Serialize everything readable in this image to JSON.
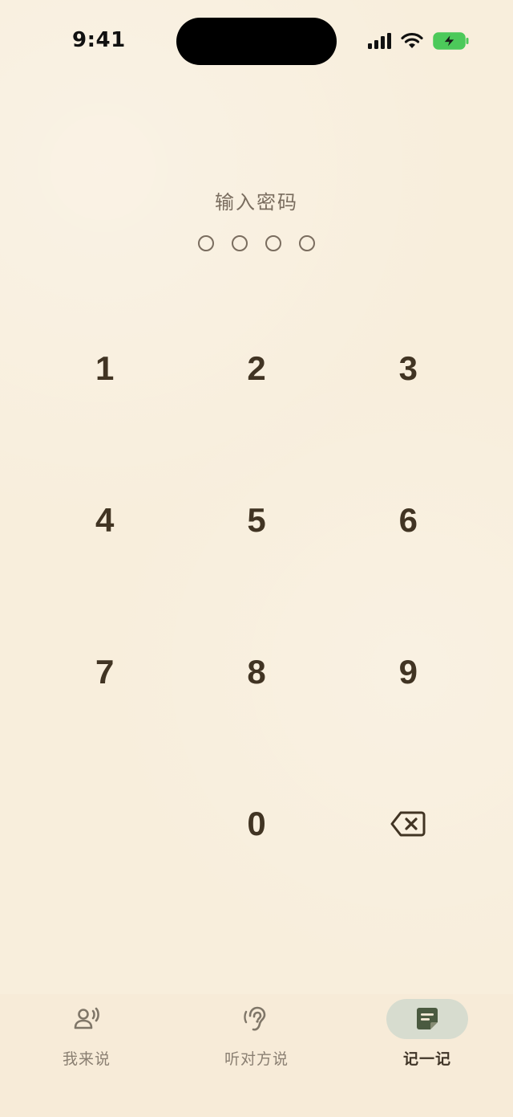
{
  "status_bar": {
    "time": "9:41",
    "icons": [
      "signal-icon",
      "wifi-icon",
      "battery-charging-icon"
    ],
    "battery_color": "#4cc95a"
  },
  "passcode": {
    "prompt": "输入密码",
    "digits_entered": 0,
    "length": 4
  },
  "keypad": {
    "keys": [
      "1",
      "2",
      "3",
      "4",
      "5",
      "6",
      "7",
      "8",
      "9",
      "0"
    ],
    "delete_icon": "backspace-icon"
  },
  "tab_bar": {
    "tabs": [
      {
        "label": "我来说",
        "icon": "speaking-person-icon",
        "active": false
      },
      {
        "label": "听对方说",
        "icon": "ear-icon",
        "active": false
      },
      {
        "label": "记一记",
        "icon": "note-icon",
        "active": true
      }
    ]
  },
  "colors": {
    "background": "#f8eedc",
    "key_text": "#413423",
    "accent_green": "#4a5a40",
    "active_tab_bg": "#d7dccf"
  }
}
